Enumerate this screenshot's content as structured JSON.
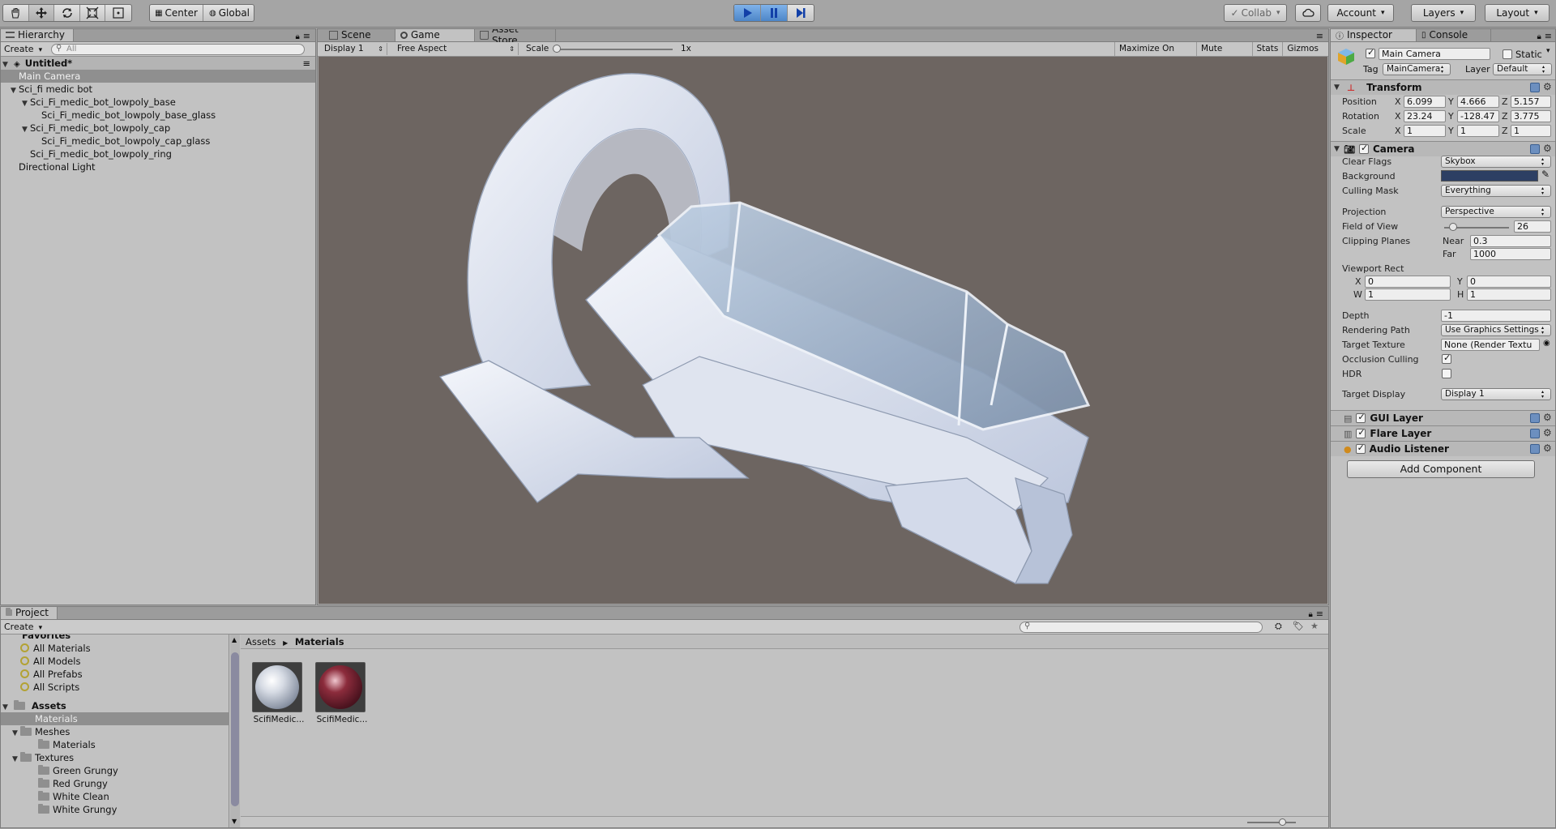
{
  "toolbar": {
    "center_label": "Center",
    "global_label": "Global",
    "collab_label": "Collab",
    "account_label": "Account",
    "layers_label": "Layers",
    "layout_label": "Layout"
  },
  "hierarchy": {
    "tab_label": "Hierarchy",
    "create_label": "Create",
    "search_placeholder": "All",
    "scene_name": "Untitled*",
    "items": [
      {
        "label": "Main Camera",
        "depth": 1,
        "selected": true
      },
      {
        "label": "Sci_fi medic bot",
        "depth": 1,
        "expanded": true
      },
      {
        "label": "Sci_Fi_medic_bot_lowpoly_base",
        "depth": 2,
        "expanded": true
      },
      {
        "label": "Sci_Fi_medic_bot_lowpoly_base_glass",
        "depth": 3
      },
      {
        "label": "Sci_Fi_medic_bot_lowpoly_cap",
        "depth": 2,
        "expanded": true
      },
      {
        "label": "Sci_Fi_medic_bot_lowpoly_cap_glass",
        "depth": 3
      },
      {
        "label": "Sci_Fi_medic_bot_lowpoly_ring",
        "depth": 2
      },
      {
        "label": "Directional Light",
        "depth": 1
      }
    ]
  },
  "center": {
    "tabs": [
      "Scene",
      "Game",
      "Asset Store"
    ],
    "display_label": "Display 1",
    "aspect_label": "Free Aspect",
    "scale_label": "Scale",
    "scale_value": "1x",
    "maximize_label": "Maximize On Play",
    "mute_label": "Mute Audio",
    "stats_label": "Stats",
    "gizmos_label": "Gizmos"
  },
  "inspector": {
    "tabs": [
      "Inspector",
      "Console"
    ],
    "object_name": "Main Camera",
    "static_label": "Static",
    "tag_label": "Tag",
    "tag_value": "MainCamera",
    "layer_label": "Layer",
    "layer_value": "Default",
    "transform": {
      "title": "Transform",
      "position_label": "Position",
      "rotation_label": "Rotation",
      "scale_label": "Scale",
      "position": [
        "6.099",
        "4.666",
        "5.157"
      ],
      "rotation": [
        "23.24",
        "-128.47",
        "3.775"
      ],
      "scale": [
        "1",
        "1",
        "1"
      ]
    },
    "camera": {
      "title": "Camera",
      "clear_flags_label": "Clear Flags",
      "clear_flags": "Skybox",
      "background_label": "Background",
      "background_color": "#2d3f63",
      "culling_mask_label": "Culling Mask",
      "culling_mask": "Everything",
      "projection_label": "Projection",
      "projection": "Perspective",
      "fov_label": "Field of View",
      "fov": "26",
      "clipping_label": "Clipping Planes",
      "near_label": "Near",
      "near": "0.3",
      "far_label": "Far",
      "far": "1000",
      "viewport_label": "Viewport Rect",
      "vp_x": "0",
      "vp_y": "0",
      "vp_w": "1",
      "vp_h": "1",
      "depth_label": "Depth",
      "depth": "-1",
      "rendering_path_label": "Rendering Path",
      "rendering_path": "Use Graphics Settings",
      "target_texture_label": "Target Texture",
      "target_texture": "None (Render Textu",
      "occlusion_label": "Occlusion Culling",
      "hdr_label": "HDR",
      "target_display_label": "Target Display",
      "target_display": "Display 1"
    },
    "components": [
      "GUI Layer",
      "Flare Layer",
      "Audio Listener"
    ],
    "add_component_label": "Add Component"
  },
  "project": {
    "tab_label": "Project",
    "create_label": "Create",
    "favorites_label": "Favorites",
    "favorites": [
      "All Materials",
      "All Models",
      "All Prefabs",
      "All Scripts"
    ],
    "assets_label": "Assets",
    "tree": [
      {
        "label": "Materials",
        "depth": 1,
        "selected": true
      },
      {
        "label": "Meshes",
        "depth": 1,
        "expanded": true
      },
      {
        "label": "Materials",
        "depth": 2
      },
      {
        "label": "Textures",
        "depth": 1,
        "expanded": true
      },
      {
        "label": "Green Grungy",
        "depth": 2
      },
      {
        "label": "Red Grungy",
        "depth": 2
      },
      {
        "label": "White Clean",
        "depth": 2
      },
      {
        "label": "White Grungy",
        "depth": 2
      }
    ],
    "breadcrumb_root": "Assets",
    "breadcrumb_current": "Materials",
    "assets": [
      "ScifiMedic...",
      "ScifiMedic..."
    ]
  }
}
